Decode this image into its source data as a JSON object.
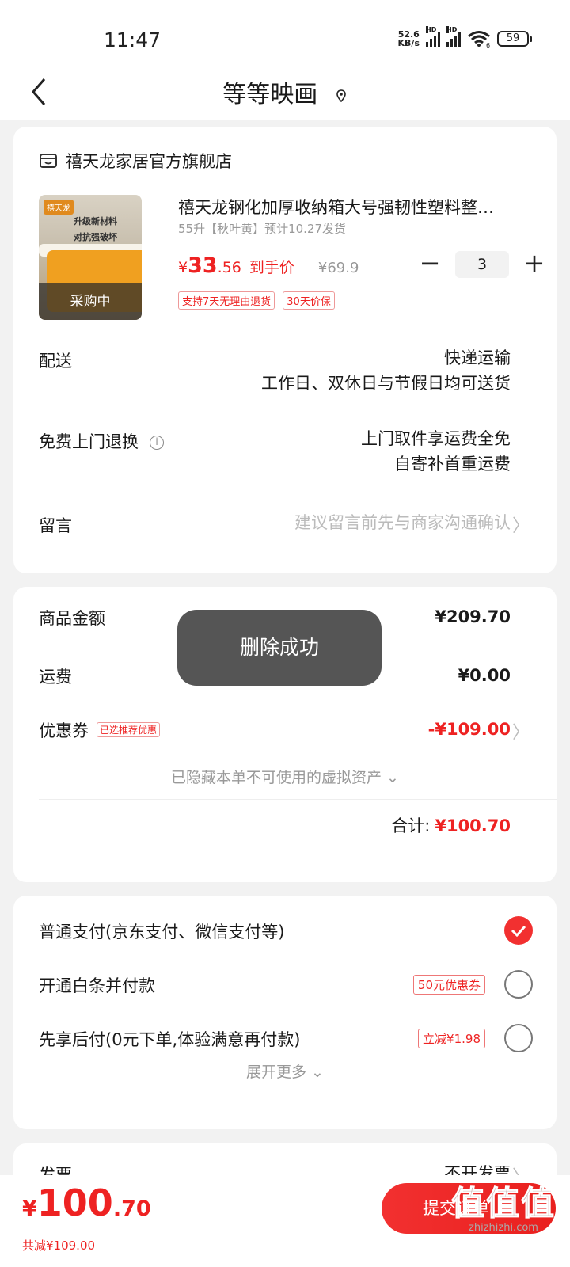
{
  "status": {
    "time": "11:47",
    "netspeed_value": "52.6",
    "netspeed_unit": "KB/s",
    "hd": "HD",
    "wifi_sub": "6",
    "battery": "59"
  },
  "nav": {
    "title": "等等映画"
  },
  "shop": {
    "name": "禧天龙家居官方旗舰店"
  },
  "product": {
    "thumb_logo": "禧天龙",
    "thumb_slogan_1": "升级新材料",
    "thumb_slogan_2": "对抗强破坏",
    "thumb_overlay": "采购中",
    "title": "禧天龙钢化加厚收纳箱大号强韧性塑料整…",
    "spec": "55升【秋叶黄】预计10.27发货",
    "price_currency": "¥",
    "price_int": "33",
    "price_dec": ".56",
    "price_label": "到手价",
    "original_price": "¥69.9",
    "qty": "3",
    "minus": "−",
    "plus": "+",
    "tags": [
      "支持7天无理由退货",
      "30天价保"
    ]
  },
  "delivery": {
    "label": "配送",
    "value1": "快递运输",
    "value2": "工作日、双休日与节假日均可送货"
  },
  "returns": {
    "label": "免费上门退换",
    "info": "i",
    "value1": "上门取件享运费全免",
    "value2": "自寄补首重运费"
  },
  "message": {
    "label": "留言",
    "placeholder": "建议留言前先与商家沟通确认",
    "chevron": "〉"
  },
  "summary": {
    "goods_label": "商品金额",
    "goods_value": "¥209.70",
    "shipping_label": "运费",
    "shipping_value": "¥0.00",
    "coupon_label": "优惠券",
    "coupon_tag": "已选推荐优惠",
    "coupon_value": "-¥109.00",
    "coupon_chevron": "〉",
    "hidden_note": "已隐藏本单不可使用的虚拟资产 ⌄",
    "total_label": "合计:",
    "total_value": "¥100.70"
  },
  "toast": {
    "text": "删除成功"
  },
  "payment": {
    "option1": "普通支付(京东支付、微信支付等)",
    "option2": "开通白条并付款",
    "option2_tag": "50元优惠券",
    "option3": "先享后付(0元下单,体验满意再付款)",
    "option3_tag": "立减¥1.98",
    "expand": "展开更多 ⌄"
  },
  "invoice": {
    "label": "发票",
    "value": "不开发票",
    "chevron": "〉"
  },
  "bottom": {
    "currency": "¥",
    "int": "100",
    "dec": ".70",
    "saved": "共减¥109.00",
    "submit": "提交订单"
  },
  "watermark": {
    "big": "值值值",
    "small": "zhizhizhi.com"
  },
  "colors": {
    "accent": "#f23030",
    "price": "#e22222"
  }
}
